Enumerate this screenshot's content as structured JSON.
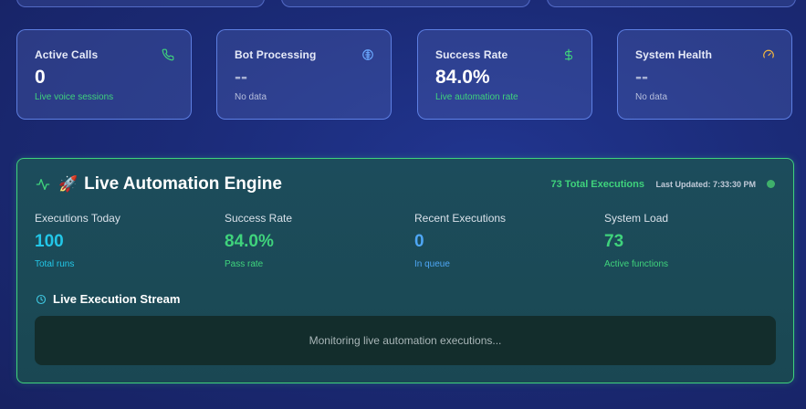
{
  "stat_cards": [
    {
      "title": "Active Calls",
      "value": "0",
      "subtitle": "Live voice sessions",
      "icon": "phone-icon",
      "icon_color": "#3fd37c",
      "sub_color": "#3fd37c"
    },
    {
      "title": "Bot Processing",
      "value": "--",
      "subtitle": "No data",
      "icon": "cpu-icon",
      "icon_color": "#6aa8ff",
      "sub_color": "#b7bfdc"
    },
    {
      "title": "Success Rate",
      "value": "84.0%",
      "subtitle": "Live automation rate",
      "icon": "dollar-icon",
      "icon_color": "#3fd37c",
      "sub_color": "#3fd37c"
    },
    {
      "title": "System Health",
      "value": "--",
      "subtitle": "No data",
      "icon": "gauge-icon",
      "icon_color": "#f5b83d",
      "sub_color": "#b7bfdc"
    }
  ],
  "engine": {
    "title": "Live Automation Engine",
    "rocket_emoji": "🚀",
    "total_executions": "73 Total Executions",
    "last_updated": "Last Updated: 7:33:30 PM",
    "status_color": "#3fb06b",
    "metrics": [
      {
        "label": "Executions Today",
        "value": "100",
        "subtitle": "Total runs",
        "color": "#22c7e8"
      },
      {
        "label": "Success Rate",
        "value": "84.0%",
        "subtitle": "Pass rate",
        "color": "#3fd37c"
      },
      {
        "label": "Recent Executions",
        "value": "0",
        "subtitle": "In queue",
        "color": "#4ea6f5"
      },
      {
        "label": "System Load",
        "value": "73",
        "subtitle": "Active functions",
        "color": "#3fd37c"
      }
    ],
    "stream": {
      "title": "Live Execution Stream",
      "empty_text": "Monitoring live automation executions..."
    }
  }
}
